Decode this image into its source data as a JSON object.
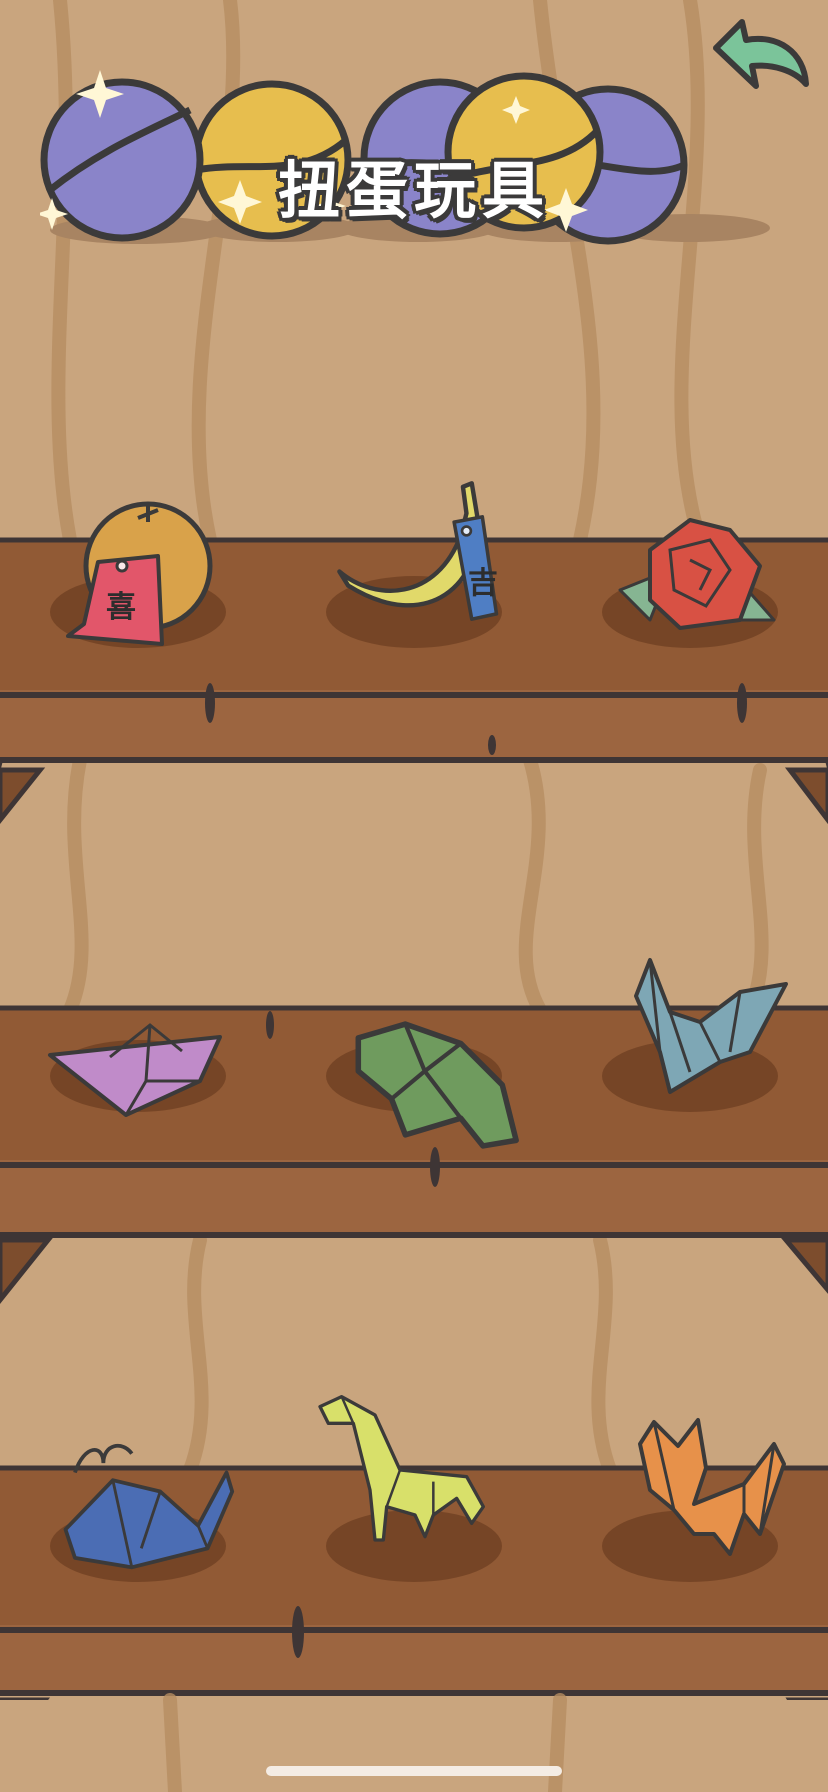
{
  "header": {
    "title": "扭蛋玩具"
  },
  "back_button": {
    "icon": "back-arrow-icon",
    "color": "#7bc49a"
  },
  "capsules": [
    "#8a84c9",
    "#e7be4e",
    "#8a84c9",
    "#e7be4e",
    "#8a84c9"
  ],
  "shelves": [
    {
      "items": [
        {
          "name": "orange",
          "tag_text": "喜",
          "tag_color": "#e2566a"
        },
        {
          "name": "banana",
          "tag_text": "吉",
          "tag_color": "#4f7ec4"
        },
        {
          "name": "origami-rose"
        }
      ]
    },
    {
      "items": [
        {
          "name": "origami-boat"
        },
        {
          "name": "origami-frog"
        },
        {
          "name": "origami-crane"
        }
      ]
    },
    {
      "items": [
        {
          "name": "origami-whale"
        },
        {
          "name": "origami-giraffe"
        },
        {
          "name": "origami-fox"
        }
      ]
    }
  ]
}
